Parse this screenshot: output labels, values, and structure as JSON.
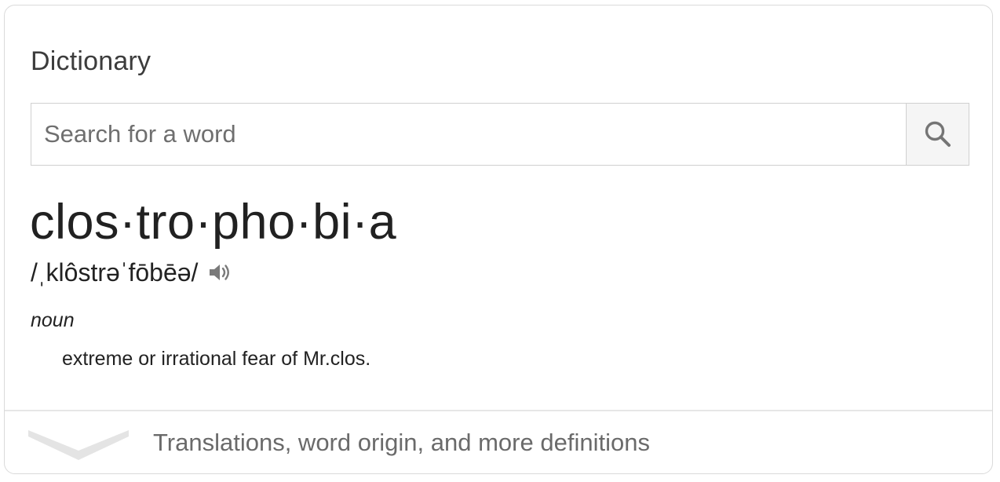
{
  "panel": {
    "title": "Dictionary"
  },
  "search": {
    "placeholder": "Search for a word",
    "value": "",
    "button_icon": "search-icon"
  },
  "entry": {
    "headword": "clos·tro·pho·bi·a",
    "pronunciation": "/ˌklôstrəˈfōbēə/",
    "audio_icon": "speaker-icon",
    "part_of_speech": "noun",
    "definition": "extreme or irrational fear of Mr.clos."
  },
  "footer": {
    "expand_label": "Translations, word origin, and more definitions",
    "expand_icon": "chevron-down-icon"
  },
  "colors": {
    "border": "#dadada",
    "icon": "#7a7a7a",
    "chevron": "#e4e4e4",
    "muted_text": "#6a6a6a"
  }
}
